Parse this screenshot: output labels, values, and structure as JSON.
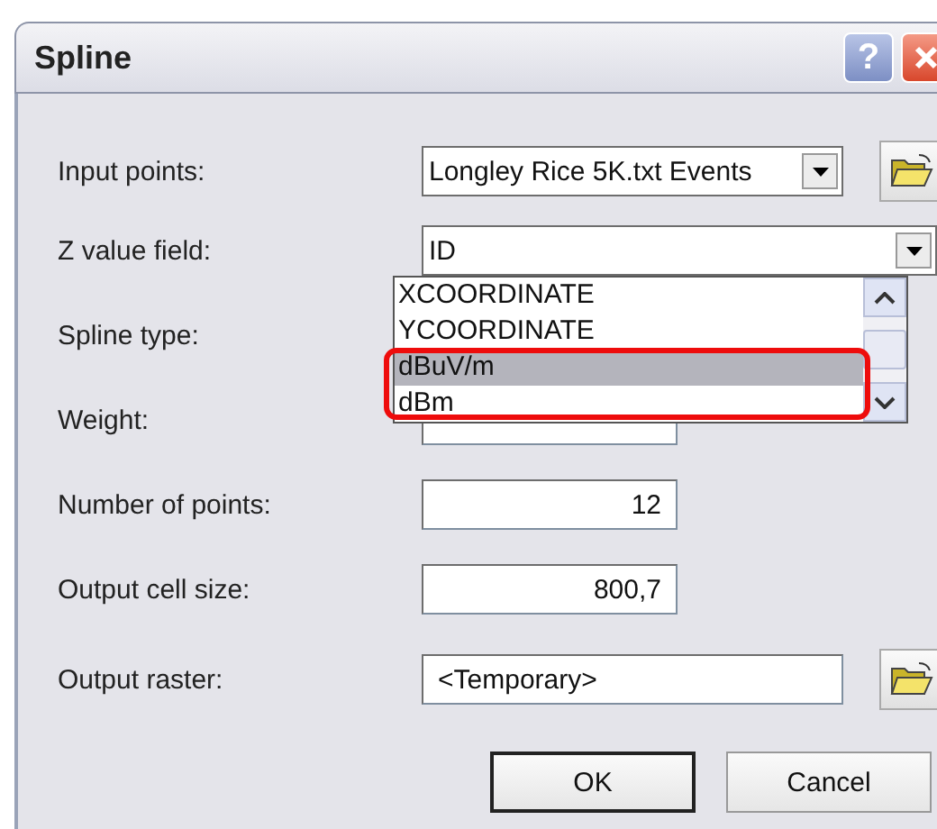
{
  "window": {
    "title": "Spline"
  },
  "title_buttons": [
    {
      "kind": "help",
      "label": "?"
    },
    {
      "kind": "close"
    }
  ],
  "fields": [
    {
      "label": "Input points:",
      "kind": "combo",
      "value": "Longley Rice 5K.txt Events",
      "browse": true
    },
    {
      "label": "Z value field:",
      "kind": "combo-wide",
      "value": "ID",
      "browse": false
    },
    {
      "label": "Spline type:",
      "kind": "hidden",
      "browse": false
    },
    {
      "label": "Weight:",
      "kind": "covered",
      "browse": false
    },
    {
      "label": "Number of points:",
      "kind": "number",
      "value": "12",
      "browse": false
    },
    {
      "label": "Output cell size:",
      "kind": "number",
      "value": "800,7",
      "browse": false
    },
    {
      "label": "Output raster:",
      "kind": "text",
      "value": "<Temporary>",
      "browse": true
    }
  ],
  "dropdown": {
    "items": [
      {
        "label": "XCOORDINATE",
        "selected": false
      },
      {
        "label": "YCOORDINATE",
        "selected": false
      },
      {
        "label": "dBuV/m",
        "selected": true
      },
      {
        "label": "dBm",
        "selected": false
      }
    ]
  },
  "buttons": [
    {
      "label": "OK",
      "default": true
    },
    {
      "label": "Cancel",
      "default": false
    }
  ]
}
